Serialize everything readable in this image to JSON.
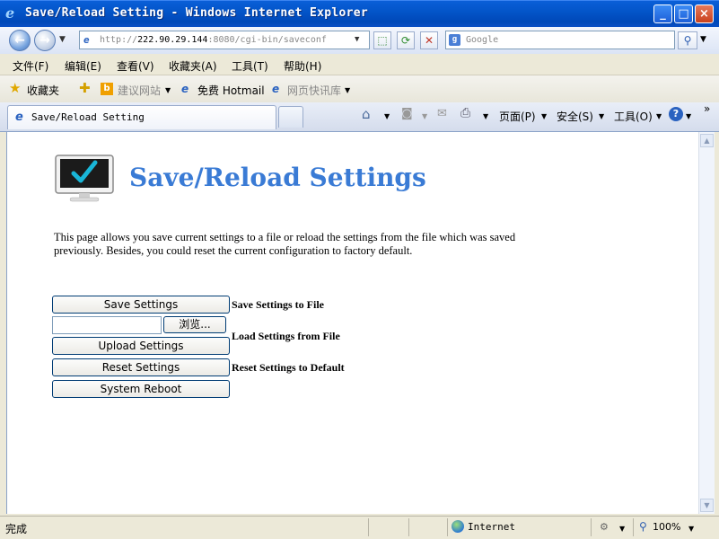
{
  "window": {
    "title": "Save/Reload Setting - Windows Internet Explorer"
  },
  "address": {
    "prefix": "http://",
    "host": "222.90.29.144",
    "rest": ":8080/cgi-bin/saveconf"
  },
  "search": {
    "placeholder": "Google"
  },
  "menu": [
    "文件(F)",
    "编辑(E)",
    "查看(V)",
    "收藏夹(A)",
    "工具(T)",
    "帮助(H)"
  ],
  "favorites": {
    "label": "收藏夹",
    "items": [
      "建议网站",
      "免费 Hotmail",
      "网页快讯库"
    ]
  },
  "tab": {
    "title": "Save/Reload Setting"
  },
  "toolbar": {
    "page": "页面(P)",
    "safety": "安全(S)",
    "tools": "工具(O)"
  },
  "page": {
    "heading": "Save/Reload Settings",
    "description": "This page allows you save current settings to a file or reload the settings from the file which was saved previously. Besides, you could reset the current configuration to factory default.",
    "save_button": "Save Settings",
    "save_label": "Save Settings to File",
    "browse_button": "浏览...",
    "upload_button": "Upload Settings",
    "upload_label": "Load Settings from File",
    "reset_button": "Reset Settings",
    "reset_label": "Reset Settings to Default",
    "reboot_button": "System Reboot"
  },
  "status": {
    "text": "完成",
    "zone": "Internet",
    "zoom": "100%"
  },
  "colors": {
    "heading": "#3a7bd5",
    "titlebar": "#0355c9"
  }
}
